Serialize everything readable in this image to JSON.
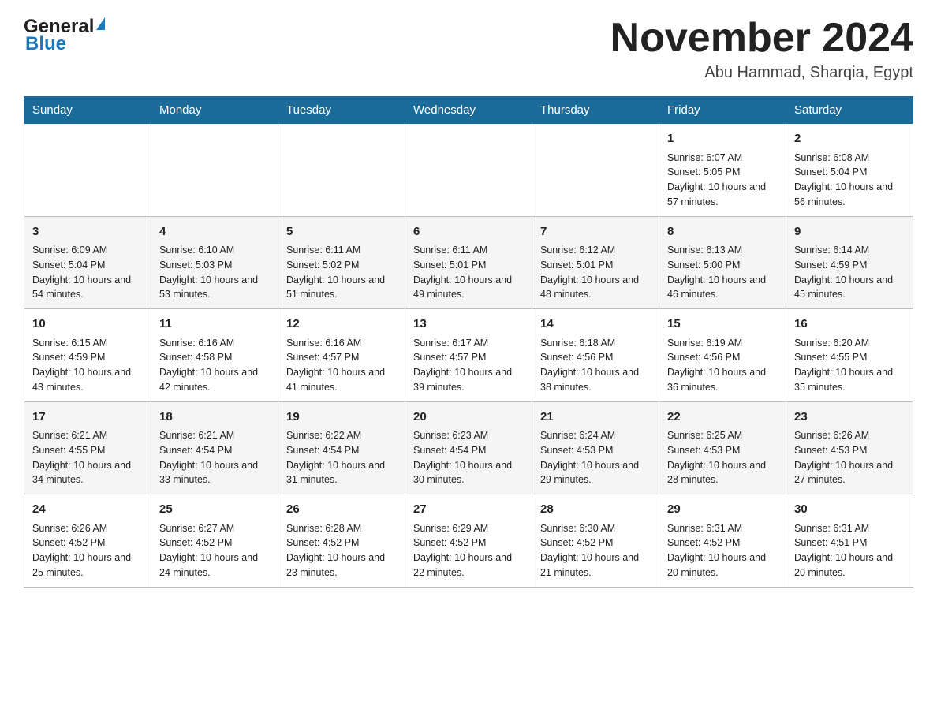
{
  "header": {
    "logo_general": "General",
    "logo_blue": "Blue",
    "month_title": "November 2024",
    "location": "Abu Hammad, Sharqia, Egypt"
  },
  "weekdays": [
    "Sunday",
    "Monday",
    "Tuesday",
    "Wednesday",
    "Thursday",
    "Friday",
    "Saturday"
  ],
  "weeks": [
    [
      {
        "day": "",
        "info": ""
      },
      {
        "day": "",
        "info": ""
      },
      {
        "day": "",
        "info": ""
      },
      {
        "day": "",
        "info": ""
      },
      {
        "day": "",
        "info": ""
      },
      {
        "day": "1",
        "info": "Sunrise: 6:07 AM\nSunset: 5:05 PM\nDaylight: 10 hours and 57 minutes."
      },
      {
        "day": "2",
        "info": "Sunrise: 6:08 AM\nSunset: 5:04 PM\nDaylight: 10 hours and 56 minutes."
      }
    ],
    [
      {
        "day": "3",
        "info": "Sunrise: 6:09 AM\nSunset: 5:04 PM\nDaylight: 10 hours and 54 minutes."
      },
      {
        "day": "4",
        "info": "Sunrise: 6:10 AM\nSunset: 5:03 PM\nDaylight: 10 hours and 53 minutes."
      },
      {
        "day": "5",
        "info": "Sunrise: 6:11 AM\nSunset: 5:02 PM\nDaylight: 10 hours and 51 minutes."
      },
      {
        "day": "6",
        "info": "Sunrise: 6:11 AM\nSunset: 5:01 PM\nDaylight: 10 hours and 49 minutes."
      },
      {
        "day": "7",
        "info": "Sunrise: 6:12 AM\nSunset: 5:01 PM\nDaylight: 10 hours and 48 minutes."
      },
      {
        "day": "8",
        "info": "Sunrise: 6:13 AM\nSunset: 5:00 PM\nDaylight: 10 hours and 46 minutes."
      },
      {
        "day": "9",
        "info": "Sunrise: 6:14 AM\nSunset: 4:59 PM\nDaylight: 10 hours and 45 minutes."
      }
    ],
    [
      {
        "day": "10",
        "info": "Sunrise: 6:15 AM\nSunset: 4:59 PM\nDaylight: 10 hours and 43 minutes."
      },
      {
        "day": "11",
        "info": "Sunrise: 6:16 AM\nSunset: 4:58 PM\nDaylight: 10 hours and 42 minutes."
      },
      {
        "day": "12",
        "info": "Sunrise: 6:16 AM\nSunset: 4:57 PM\nDaylight: 10 hours and 41 minutes."
      },
      {
        "day": "13",
        "info": "Sunrise: 6:17 AM\nSunset: 4:57 PM\nDaylight: 10 hours and 39 minutes."
      },
      {
        "day": "14",
        "info": "Sunrise: 6:18 AM\nSunset: 4:56 PM\nDaylight: 10 hours and 38 minutes."
      },
      {
        "day": "15",
        "info": "Sunrise: 6:19 AM\nSunset: 4:56 PM\nDaylight: 10 hours and 36 minutes."
      },
      {
        "day": "16",
        "info": "Sunrise: 6:20 AM\nSunset: 4:55 PM\nDaylight: 10 hours and 35 minutes."
      }
    ],
    [
      {
        "day": "17",
        "info": "Sunrise: 6:21 AM\nSunset: 4:55 PM\nDaylight: 10 hours and 34 minutes."
      },
      {
        "day": "18",
        "info": "Sunrise: 6:21 AM\nSunset: 4:54 PM\nDaylight: 10 hours and 33 minutes."
      },
      {
        "day": "19",
        "info": "Sunrise: 6:22 AM\nSunset: 4:54 PM\nDaylight: 10 hours and 31 minutes."
      },
      {
        "day": "20",
        "info": "Sunrise: 6:23 AM\nSunset: 4:54 PM\nDaylight: 10 hours and 30 minutes."
      },
      {
        "day": "21",
        "info": "Sunrise: 6:24 AM\nSunset: 4:53 PM\nDaylight: 10 hours and 29 minutes."
      },
      {
        "day": "22",
        "info": "Sunrise: 6:25 AM\nSunset: 4:53 PM\nDaylight: 10 hours and 28 minutes."
      },
      {
        "day": "23",
        "info": "Sunrise: 6:26 AM\nSunset: 4:53 PM\nDaylight: 10 hours and 27 minutes."
      }
    ],
    [
      {
        "day": "24",
        "info": "Sunrise: 6:26 AM\nSunset: 4:52 PM\nDaylight: 10 hours and 25 minutes."
      },
      {
        "day": "25",
        "info": "Sunrise: 6:27 AM\nSunset: 4:52 PM\nDaylight: 10 hours and 24 minutes."
      },
      {
        "day": "26",
        "info": "Sunrise: 6:28 AM\nSunset: 4:52 PM\nDaylight: 10 hours and 23 minutes."
      },
      {
        "day": "27",
        "info": "Sunrise: 6:29 AM\nSunset: 4:52 PM\nDaylight: 10 hours and 22 minutes."
      },
      {
        "day": "28",
        "info": "Sunrise: 6:30 AM\nSunset: 4:52 PM\nDaylight: 10 hours and 21 minutes."
      },
      {
        "day": "29",
        "info": "Sunrise: 6:31 AM\nSunset: 4:52 PM\nDaylight: 10 hours and 20 minutes."
      },
      {
        "day": "30",
        "info": "Sunrise: 6:31 AM\nSunset: 4:51 PM\nDaylight: 10 hours and 20 minutes."
      }
    ]
  ]
}
